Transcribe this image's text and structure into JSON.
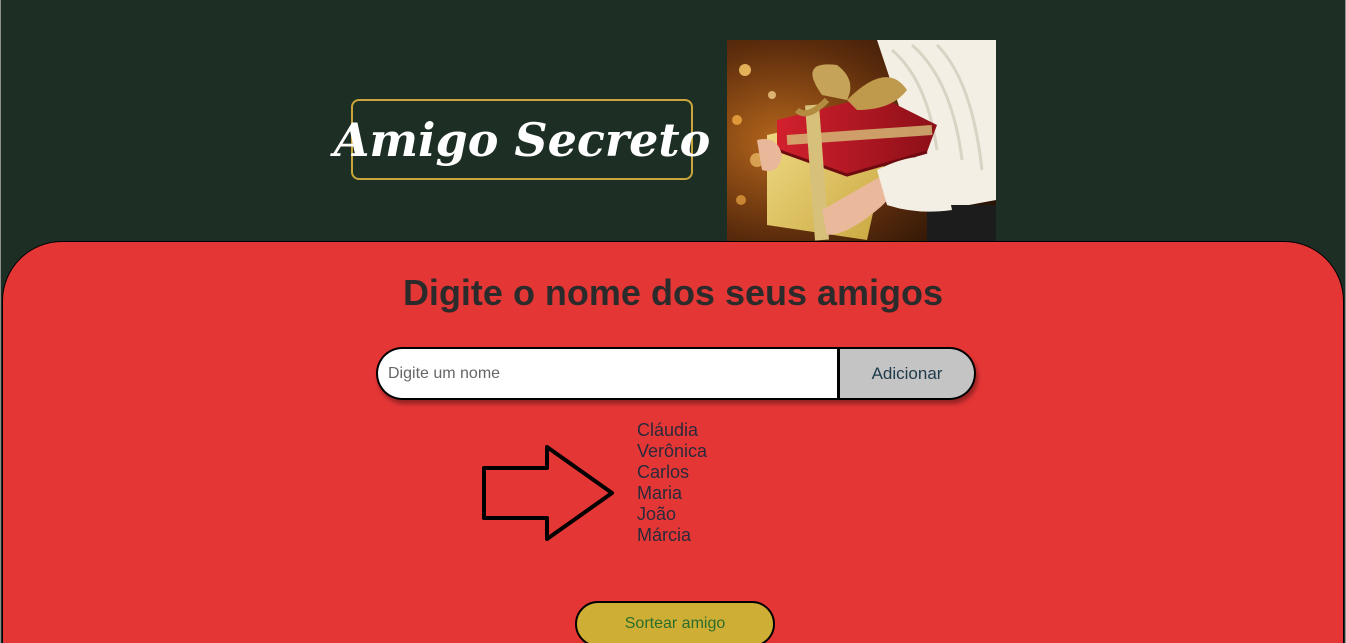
{
  "header": {
    "title": "Amigo Secreto"
  },
  "main": {
    "heading": "Digite o nome dos seus amigos",
    "input": {
      "placeholder": "Digite um nome",
      "value": ""
    },
    "add_button": "Adicionar",
    "friends": [
      "Cláudia",
      "Verônica",
      "Carlos",
      "Maria",
      "João",
      "Márcia"
    ],
    "draw_button": "Sortear amigo"
  },
  "colors": {
    "header_bg": "#1d2e24",
    "main_bg": "#e53636",
    "title_border": "#c9a53b",
    "draw_button_bg": "#cfae35",
    "add_button_bg": "#c4c4c4"
  }
}
